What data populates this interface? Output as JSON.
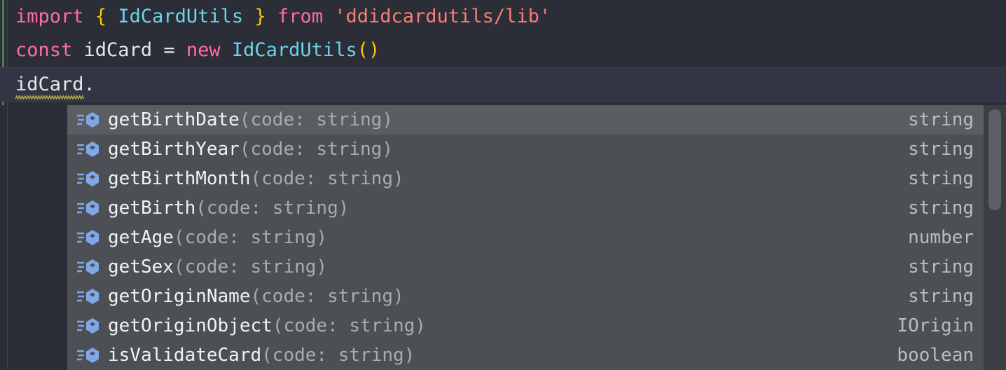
{
  "editor": {
    "background": "#2b2d37",
    "vcs_marker_color": "#4f7a52",
    "current_line_background": "#323644",
    "lines": [
      {
        "id": "line1",
        "tokens": [
          {
            "text": "import",
            "kind": "keyword"
          },
          {
            "text": " ",
            "kind": "plain"
          },
          {
            "text": "{",
            "kind": "bracket"
          },
          {
            "text": " ",
            "kind": "plain"
          },
          {
            "text": "IdCardUtils",
            "kind": "class"
          },
          {
            "text": " ",
            "kind": "plain"
          },
          {
            "text": "}",
            "kind": "bracket"
          },
          {
            "text": " ",
            "kind": "plain"
          },
          {
            "text": "from",
            "kind": "keyword"
          },
          {
            "text": " ",
            "kind": "plain"
          },
          {
            "text": "'ddidcardutils/lib'",
            "kind": "string"
          }
        ]
      },
      {
        "id": "line2",
        "tokens": [
          {
            "text": "const",
            "kind": "keyword"
          },
          {
            "text": " idCard = ",
            "kind": "plain"
          },
          {
            "text": "new",
            "kind": "keyword"
          },
          {
            "text": " ",
            "kind": "plain"
          },
          {
            "text": "IdCardUtils",
            "kind": "class"
          },
          {
            "text": "()",
            "kind": "bracket"
          }
        ]
      },
      {
        "id": "line3",
        "current": true,
        "error_underline": true,
        "tokens": [
          {
            "text": "idCard",
            "kind": "plain",
            "squiggly": true
          },
          {
            "text": ".",
            "kind": "plain"
          }
        ]
      }
    ]
  },
  "autocomplete": {
    "background": "#4c5055",
    "selected_background": "#5a5e63",
    "icon_name": "method-icon",
    "icon_color": "#81a7e8",
    "scrollbar": {
      "track_color": "#3b3e43",
      "thumb_color": "#5d6065"
    },
    "items": [
      {
        "name": "getBirthDate",
        "params": "(code: string)",
        "type": "string",
        "selected": true
      },
      {
        "name": "getBirthYear",
        "params": "(code: string)",
        "type": "string",
        "selected": false
      },
      {
        "name": "getBirthMonth",
        "params": "(code: string)",
        "type": "string",
        "selected": false
      },
      {
        "name": "getBirth",
        "params": "(code: string)",
        "type": "string",
        "selected": false
      },
      {
        "name": "getAge",
        "params": "(code: string)",
        "type": "number",
        "selected": false
      },
      {
        "name": "getSex",
        "params": "(code: string)",
        "type": "string",
        "selected": false
      },
      {
        "name": "getOriginName",
        "params": "(code: string)",
        "type": "string",
        "selected": false
      },
      {
        "name": "getOriginObject",
        "params": "(code: string)",
        "type": "IOrigin",
        "selected": false
      },
      {
        "name": "isValidateCard",
        "params": "(code: string)",
        "type": "boolean",
        "selected": false
      }
    ]
  }
}
